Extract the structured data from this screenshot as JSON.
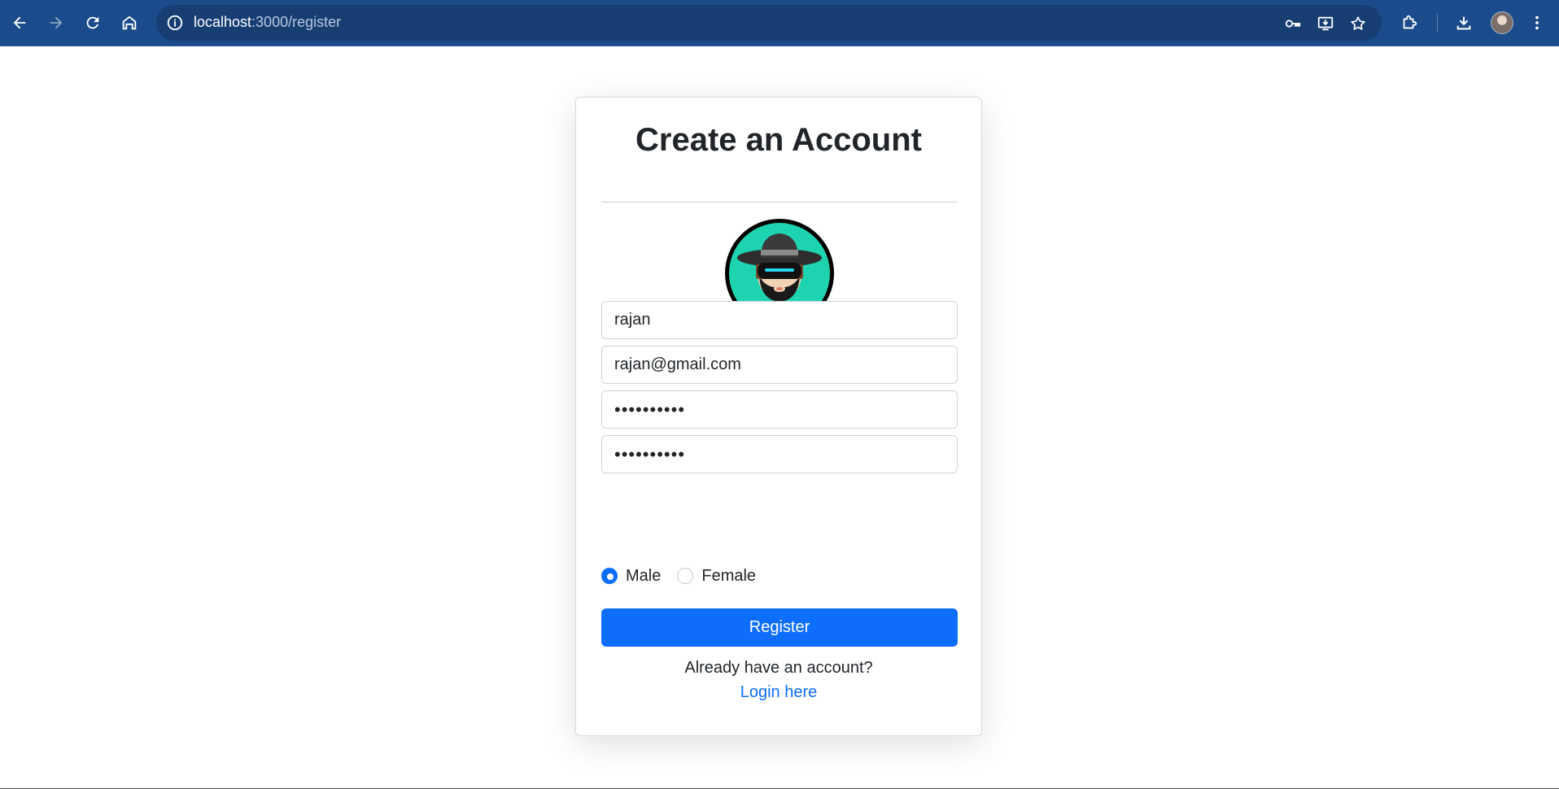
{
  "browser": {
    "url_host": "localhost",
    "url_path": ":3000/register",
    "nav_icons": [
      "back-icon",
      "forward-icon",
      "reload-icon",
      "home-icon"
    ],
    "omnibox_icons": [
      "site-info-icon",
      "password-key-icon",
      "install-app-icon",
      "bookmark-star-icon"
    ],
    "toolbar_icons": [
      "extensions-icon",
      "download-icon",
      "profile-avatar",
      "menu-icon"
    ],
    "chrome_color": "#1b4b8a"
  },
  "form": {
    "title": "Create an Account",
    "avatar_icon": "user-avatar-hat-visor",
    "name_value": "rajan",
    "email_value": "rajan@gmail.com",
    "password_value": "••••••••••",
    "confirm_password_value": "••••••••••",
    "gender_options": [
      {
        "label": "Male",
        "checked": true
      },
      {
        "label": "Female",
        "checked": false
      }
    ],
    "submit_label": "Register",
    "footer_text": "Already have an account?",
    "login_link": "Login here",
    "accent_color": "#0d6efd"
  }
}
